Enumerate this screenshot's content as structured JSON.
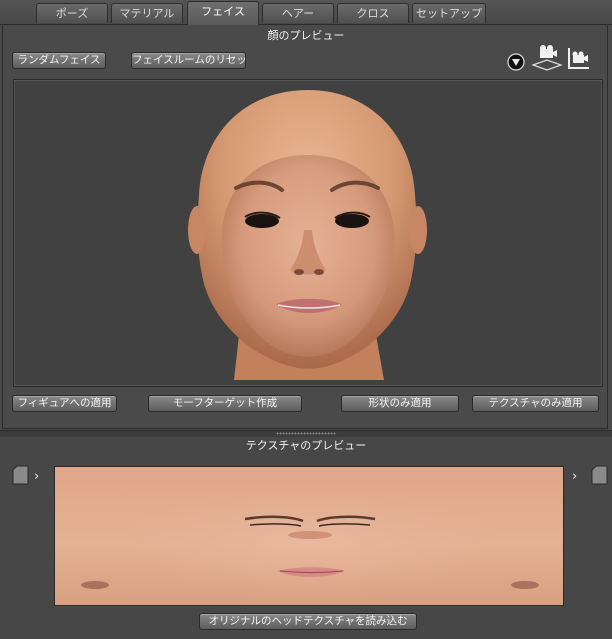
{
  "tabs": [
    {
      "label": "ポーズ",
      "active": false
    },
    {
      "label": "マテリアル",
      "active": false
    },
    {
      "label": "フェイス",
      "active": true
    },
    {
      "label": "ヘアー",
      "active": false
    },
    {
      "label": "クロス",
      "active": false
    },
    {
      "label": "セットアップ",
      "active": false
    }
  ],
  "face_preview": {
    "title": "顔のプレビュー",
    "random_face_button": "ランダムフェイス",
    "face_room_reset_button": "フェイスルームのリセッ...",
    "view_icons": [
      "light-sphere-icon",
      "camera-pan-icon",
      "camera-rotate-icon"
    ],
    "apply_to_figure_button": "フィギュアへの適用",
    "create_morph_target_button": "モーフターゲット作成",
    "apply_shape_only_button": "形状のみ適用",
    "apply_texture_only_button": "テクスチャのみ適用"
  },
  "texture_preview": {
    "title": "テクスチャのプレビュー",
    "load_original_button": "オリジナルのヘッドテクスチャを読み込む"
  },
  "colors": {
    "panel_bg": "#4a4a4a",
    "viewport_bg": "#414141",
    "skin": "#d9a07a"
  }
}
